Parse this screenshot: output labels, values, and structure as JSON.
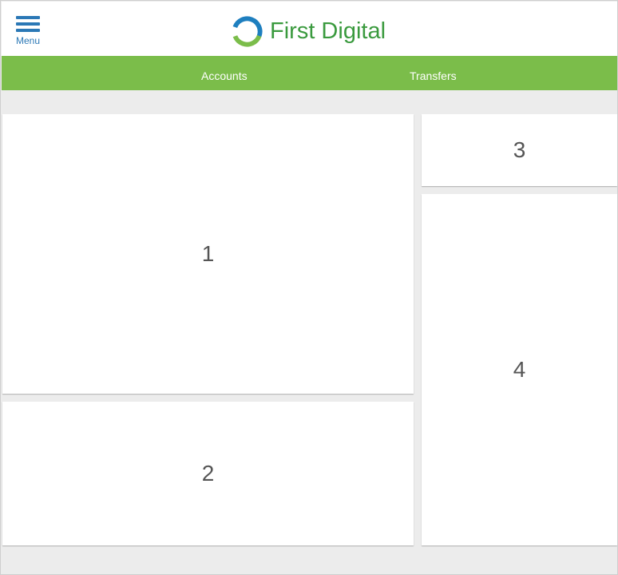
{
  "header": {
    "menu_label": "Menu",
    "brand_name": "First Digital"
  },
  "nav": {
    "items": [
      {
        "label": "Accounts"
      },
      {
        "label": "Transfers"
      }
    ]
  },
  "panels": [
    {
      "label": "1"
    },
    {
      "label": "2"
    },
    {
      "label": "3"
    },
    {
      "label": "4"
    }
  ],
  "colors": {
    "brand_green": "#7bbd4a",
    "logo_green": "#3a9a3e",
    "menu_blue": "#2b78b6",
    "background": "#ececec"
  },
  "icons": {
    "menu": "hamburger-icon",
    "logo": "ring-logo-icon"
  }
}
